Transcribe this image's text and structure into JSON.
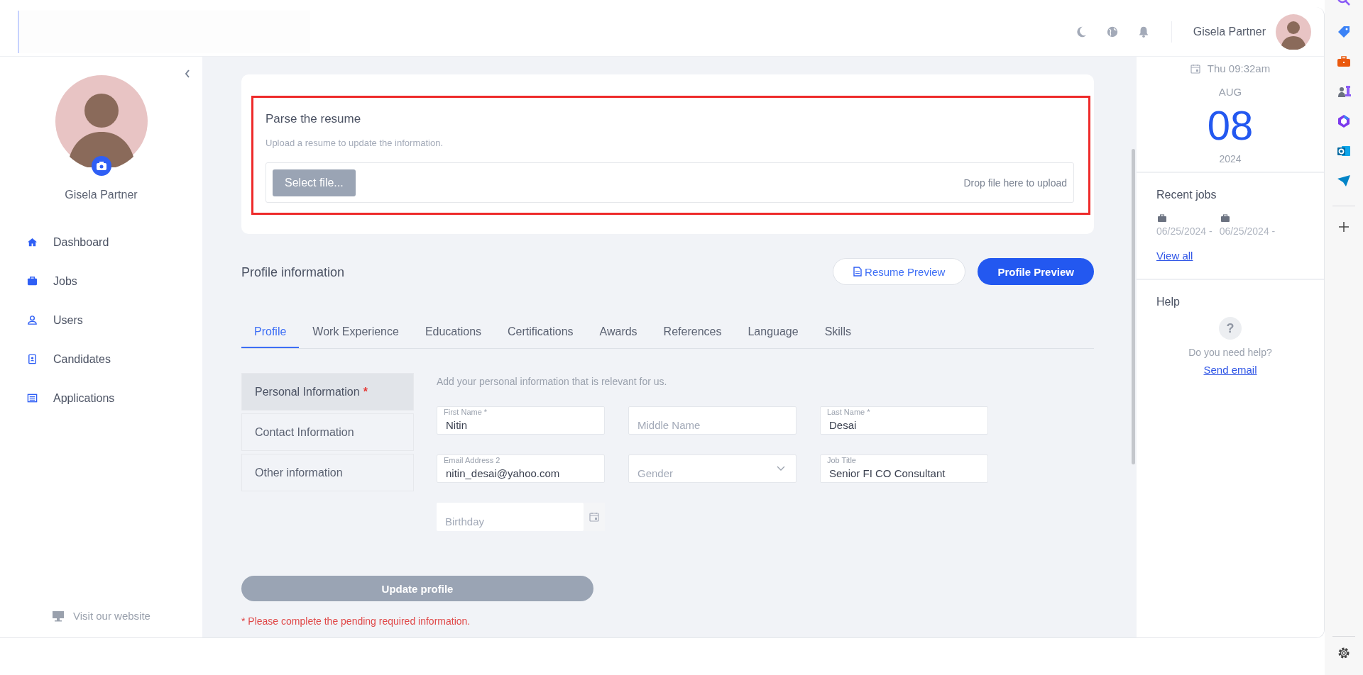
{
  "top_bar": {
    "user_name": "Gisela Partner"
  },
  "sidebar": {
    "user_name": "Gisela Partner",
    "items": [
      {
        "label": "Dashboard"
      },
      {
        "label": "Jobs"
      },
      {
        "label": "Users"
      },
      {
        "label": "Candidates"
      },
      {
        "label": "Applications"
      }
    ],
    "footer_link": "Visit our website"
  },
  "upload": {
    "title": "Parse the resume",
    "subtitle": "Upload a resume to update the information.",
    "button": "Select file...",
    "drop_hint": "Drop file here to upload"
  },
  "profile": {
    "title": "Profile information",
    "buttons": [
      {
        "label": "Resume Preview",
        "kind": "outline"
      },
      {
        "label": "Profile Preview",
        "kind": "primary"
      }
    ],
    "tabs": [
      {
        "label": "Profile",
        "selected": true
      },
      {
        "label": "Work Experience",
        "selected": false
      },
      {
        "label": "Educations",
        "selected": false
      },
      {
        "label": "Certifications",
        "selected": false
      },
      {
        "label": "Awards",
        "selected": false
      },
      {
        "label": "References",
        "selected": false
      },
      {
        "label": "Language",
        "selected": false
      },
      {
        "label": "Skills",
        "selected": false
      }
    ],
    "sections": [
      {
        "label": "Personal Information",
        "required_mark": "*",
        "selected": true
      },
      {
        "label": "Contact Information",
        "selected": false
      },
      {
        "label": "Other information",
        "selected": false
      }
    ],
    "intro": "Add your personal information that is relevant for us.",
    "fields": [
      {
        "kind": "text",
        "label": "First Name *",
        "value": "Nitin"
      },
      {
        "kind": "text",
        "placeholder": "Middle Name"
      },
      {
        "kind": "text",
        "label": "Last Name *",
        "value": "Desai"
      },
      {
        "kind": "text",
        "label": "Email Address 2",
        "value": "nitin_desai@yahoo.com"
      },
      {
        "kind": "select",
        "placeholder": "Gender"
      },
      {
        "kind": "text",
        "label": "Job Title",
        "value": "Senior FI CO Consultant"
      },
      {
        "kind": "date",
        "placeholder": "Birthday"
      }
    ],
    "submit": {
      "label": "Update profile",
      "disabled": true
    },
    "error": "* Please complete the pending required information."
  },
  "right_panel": {
    "clock": "Thu 09:32am",
    "month": "AUG",
    "day": "08",
    "year": "2024",
    "recent_jobs": {
      "title": "Recent jobs",
      "items": [
        {
          "date": "06/25/2024 -"
        },
        {
          "date": "06/25/2024 -"
        }
      ],
      "link": "View all"
    },
    "help": {
      "title": "Help",
      "icon_text": "?",
      "text": "Do you need help?",
      "link": "Send email"
    }
  }
}
